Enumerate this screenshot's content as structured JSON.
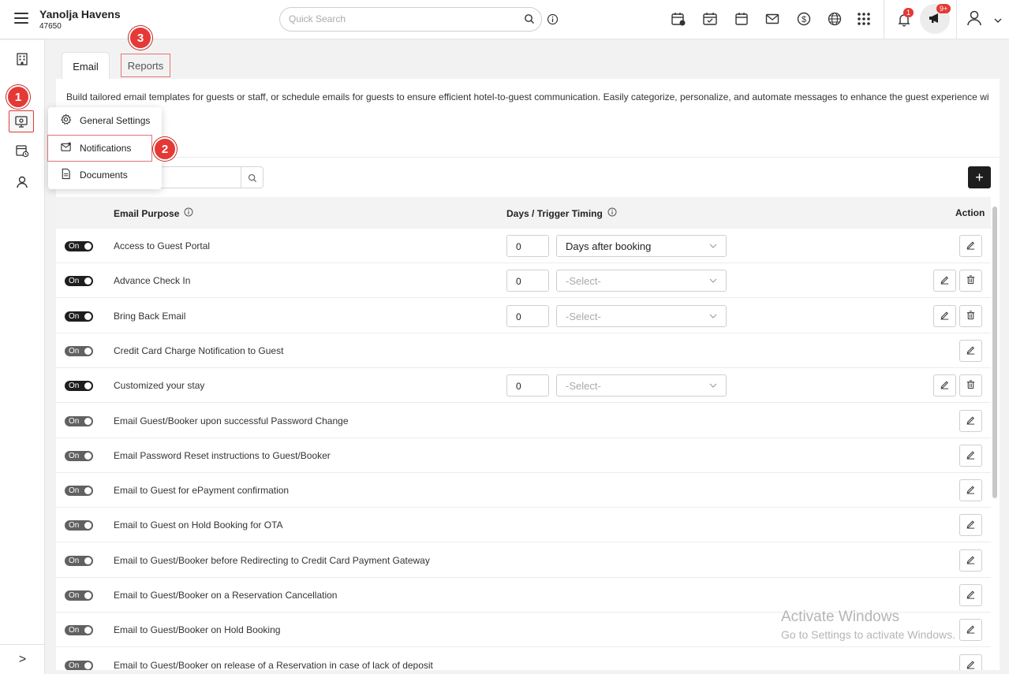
{
  "header": {
    "hotel_name": "Yanolja Havens",
    "hotel_id": "47650",
    "search_placeholder": "Quick Search",
    "notification_count": "1",
    "announcement_count": "9+"
  },
  "sidebar": {
    "expand_label": ">"
  },
  "steps": [
    "1",
    "2",
    "3"
  ],
  "tabs": {
    "email": "Email",
    "reports": "Reports"
  },
  "menu": {
    "items": [
      "General Settings",
      "Notifications",
      "Documents"
    ]
  },
  "description": "Build tailored email templates for guests or staff, or schedule emails for guests to ensure efficient hotel-to-guest communication. Easily categorize, personalize, and automate messages to enhance the guest experience with",
  "table": {
    "col_purpose": "Email Purpose",
    "col_timing": "Days / Trigger Timing",
    "col_action": "Action",
    "toggle_label": "On",
    "rows": [
      {
        "purpose": "Access to Guest Portal",
        "enabled": true,
        "days": "0",
        "timing": "Days after booking",
        "deletable": false
      },
      {
        "purpose": "Advance Check In",
        "enabled": true,
        "days": "0",
        "timing": "-Select-",
        "deletable": true
      },
      {
        "purpose": "Bring Back Email",
        "enabled": true,
        "days": "0",
        "timing": "-Select-",
        "deletable": true
      },
      {
        "purpose": "Credit Card Charge Notification to Guest",
        "enabled": false,
        "deletable": false
      },
      {
        "purpose": "Customized your stay",
        "enabled": true,
        "days": "0",
        "timing": "-Select-",
        "deletable": true
      },
      {
        "purpose": "Email Guest/Booker upon successful Password Change",
        "enabled": false,
        "deletable": false
      },
      {
        "purpose": "Email Password Reset instructions to Guest/Booker",
        "enabled": false,
        "deletable": false
      },
      {
        "purpose": "Email to Guest for ePayment confirmation",
        "enabled": false,
        "deletable": false
      },
      {
        "purpose": "Email to Guest on Hold Booking for OTA",
        "enabled": false,
        "deletable": false
      },
      {
        "purpose": "Email to Guest/Booker before Redirecting to Credit Card Payment Gateway",
        "enabled": false,
        "deletable": false
      },
      {
        "purpose": "Email to Guest/Booker on a Reservation Cancellation",
        "enabled": false,
        "deletable": false
      },
      {
        "purpose": "Email to Guest/Booker on Hold Booking",
        "enabled": false,
        "deletable": false
      },
      {
        "purpose": "Email to Guest/Booker on release of a Reservation in case of lack of deposit",
        "enabled": false,
        "deletable": false
      }
    ]
  },
  "watermark": {
    "line1": "Activate Windows",
    "line2": "Go to Settings to activate Windows."
  }
}
